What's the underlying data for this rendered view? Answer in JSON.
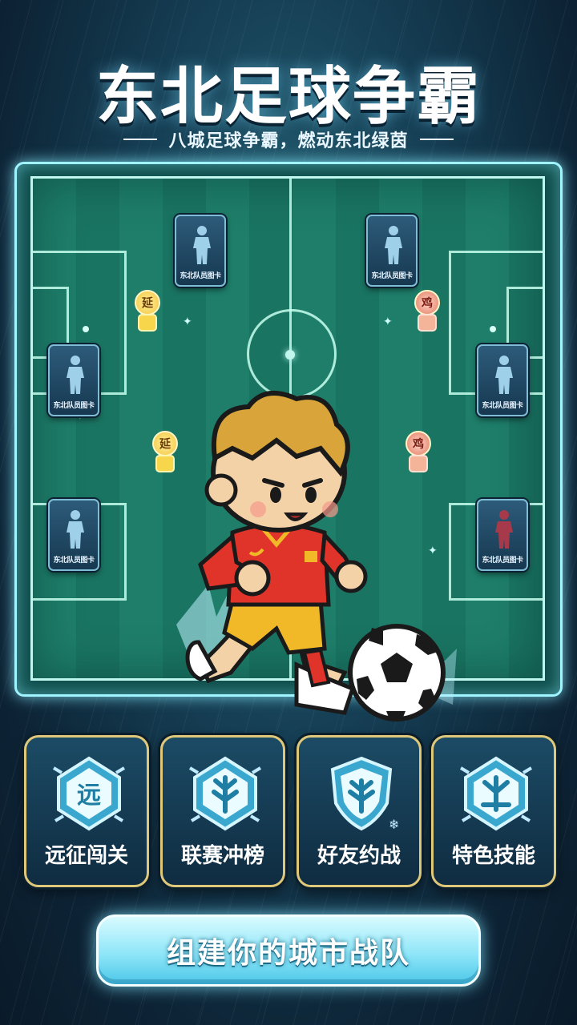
{
  "header": {
    "title": "东北足球争霸",
    "subtitle": "八城足球争霸，燃动东北绿茵"
  },
  "pitch": {
    "cards": [
      {
        "id": "card-top-left",
        "name": "东北队员图卡",
        "team": "blue"
      },
      {
        "id": "card-mid-left",
        "name": "东北队员图卡",
        "team": "blue"
      },
      {
        "id": "card-low-left",
        "name": "东北队员图卡",
        "team": "blue"
      },
      {
        "id": "card-top-right",
        "name": "东北队员图卡",
        "team": "blue"
      },
      {
        "id": "card-mid-right",
        "name": "东北队员图卡",
        "team": "blue"
      },
      {
        "id": "card-low-right",
        "name": "东北队员图卡",
        "team": "red"
      }
    ],
    "tokens": [
      {
        "label": "延",
        "color": "gold"
      },
      {
        "label": "延",
        "color": "gold"
      },
      {
        "label": "鸡",
        "color": "red"
      },
      {
        "label": "鸡",
        "color": "red"
      }
    ]
  },
  "features": [
    {
      "label": "远征闯关",
      "icon": "expedition-icon",
      "emblem_text": "远"
    },
    {
      "label": "联赛冲榜",
      "icon": "league-icon"
    },
    {
      "label": "好友约战",
      "icon": "friends-battle-icon"
    },
    {
      "label": "特色技能",
      "icon": "skill-icon"
    }
  ],
  "cta": {
    "label": "组建你的城市战队"
  },
  "colors": {
    "accent_cyan": "#8fe6f8",
    "tile_border_gold": "#e0c87a",
    "jersey_red": "#e0342a"
  }
}
